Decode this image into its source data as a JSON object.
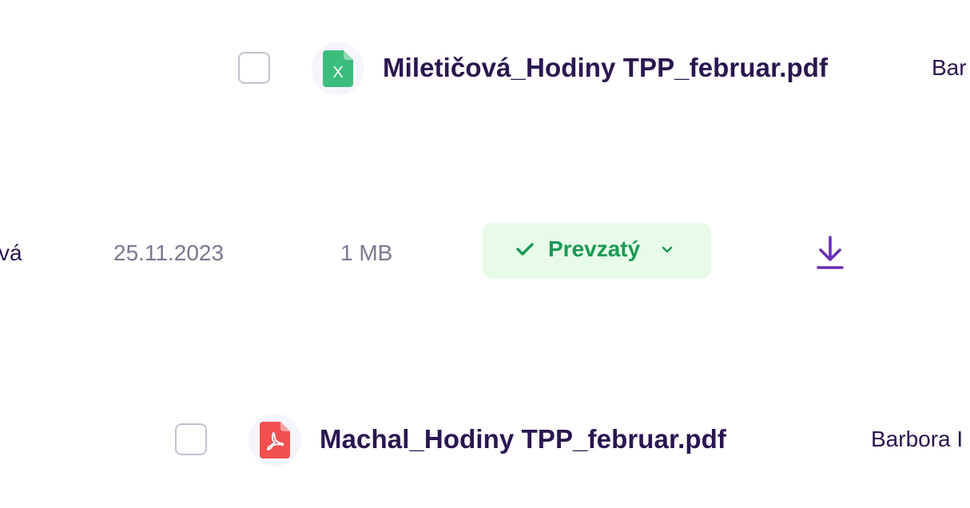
{
  "colors": {
    "text_primary": "#2a1650",
    "text_muted": "#7b7890",
    "status_bg": "#e8fbe9",
    "status_fg": "#1a9a55",
    "download_accent": "#6a2fb5",
    "excel_green": "#3dbd7d",
    "pdf_red": "#f25050"
  },
  "rows": [
    {
      "file_name": "Miletičová_Hodiny TPP_februar.pdf",
      "file_icon": "excel-file-icon",
      "owner": "Bar"
    },
    {
      "owner": "vá",
      "date": "25.11.2023",
      "size": "1 MB",
      "status": {
        "label": "Prevzatý",
        "icon": "check-icon",
        "dropdown_icon": "chevron-down-icon"
      },
      "action_icon": "download-icon"
    },
    {
      "file_name": "Machal_Hodiny TPP_februar.pdf",
      "file_icon": "pdf-file-icon",
      "owner": "Barbora I"
    }
  ]
}
